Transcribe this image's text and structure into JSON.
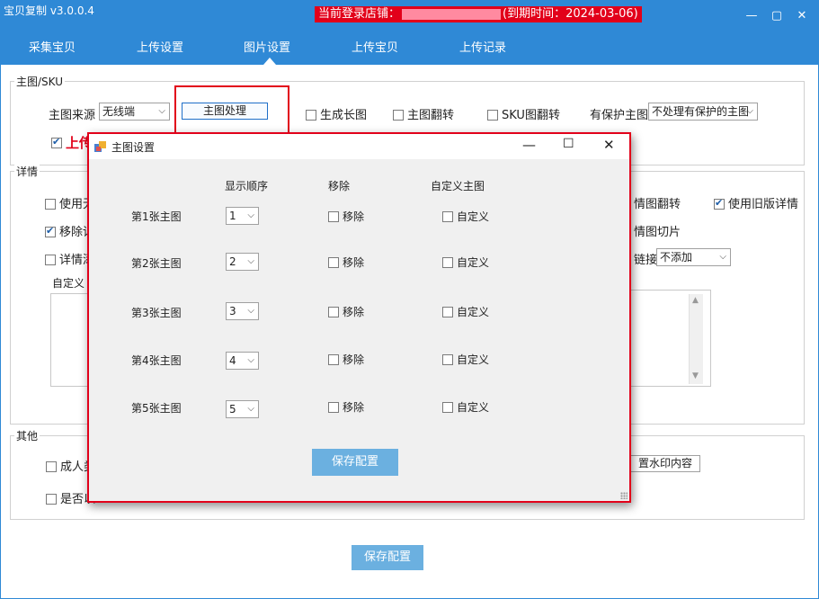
{
  "app": {
    "title": "宝贝复制 v3.0.0.4",
    "login_prefix": "当前登录店铺：",
    "login_suffix": "(到期时间：2024-03-06)",
    "window_controls": [
      "minimize-icon",
      "restore-icon",
      "close-icon"
    ]
  },
  "tabs": [
    {
      "label": "采集宝贝"
    },
    {
      "label": "上传设置"
    },
    {
      "label": "图片设置",
      "active": true
    },
    {
      "label": "上传宝贝"
    },
    {
      "label": "上传记录"
    }
  ],
  "main_sku": {
    "group_title": "主图/SKU",
    "source_label": "主图来源",
    "source_value": "无线端",
    "process_button": "主图处理",
    "gen_long_image": "生成长图",
    "flip_main": "主图翻转",
    "flip_sku": "SKU图翻转",
    "protect_label": "有保护主图",
    "protect_value": "不处理有保护的主图",
    "upload_partial": "上传"
  },
  "detail": {
    "group_title": "详情",
    "use_partial": "使用无",
    "remove_partial": "移除详",
    "detail_partial": "详情添",
    "custom_partial": "自定义",
    "flip_detail": "情图翻转",
    "use_old_detail": "使用旧版详情",
    "slice_detail": "情图切片",
    "append_label": "链接",
    "append_value": "不添加"
  },
  "other": {
    "group_title": "其他",
    "adult_partial": "成人类",
    "whether_partial": "是否以",
    "watermark_button": "置水印内容"
  },
  "save_button": "保存配置",
  "dialog": {
    "title": "主图设置",
    "col_order": "显示顺序",
    "col_remove": "移除",
    "col_custom": "自定义主图",
    "rows": [
      {
        "label": "第1张主图",
        "order": "1",
        "remove": "移除",
        "custom": "自定义"
      },
      {
        "label": "第2张主图",
        "order": "2",
        "remove": "移除",
        "custom": "自定义"
      },
      {
        "label": "第3张主图",
        "order": "3",
        "remove": "移除",
        "custom": "自定义"
      },
      {
        "label": "第4张主图",
        "order": "4",
        "remove": "移除",
        "custom": "自定义"
      },
      {
        "label": "第5张主图",
        "order": "5",
        "remove": "移除",
        "custom": "自定义"
      }
    ],
    "save_button": "保存配置"
  },
  "colors": {
    "title_bar": "#2f89d6",
    "highlight_red": "#e2001a",
    "save_button": "#6bb0e0"
  }
}
